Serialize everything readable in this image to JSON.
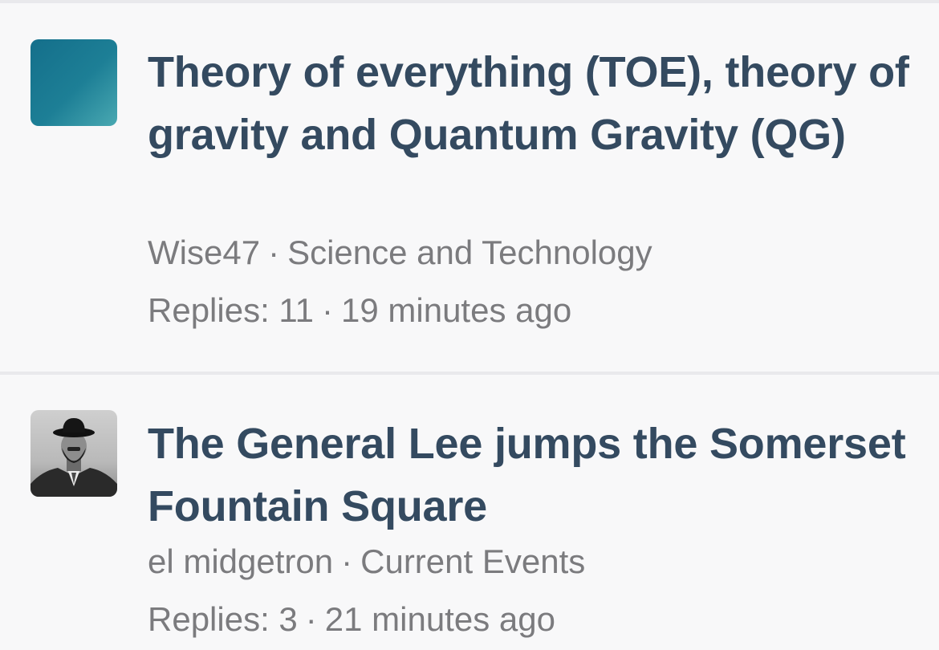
{
  "threads": [
    {
      "title": "Theory of everything (TOE), theory of gravity and Quantum Gravity (QG)",
      "author": "Wise47",
      "separator": "·",
      "forum": "Science and Technology",
      "replies": "Replies: 11",
      "time": "19 minutes ago",
      "avatar_icon": "teal-gradient-avatar"
    },
    {
      "title": "The General Lee jumps the Somerset Fountain Square",
      "author": "el midgetron",
      "separator": "·",
      "forum": "Current Events",
      "replies": "Replies: 3",
      "time": "21 minutes ago",
      "avatar_icon": "man-in-bowler-hat-avatar"
    }
  ],
  "colors": {
    "background": "#f8f8f9",
    "title": "#344a60",
    "meta": "#7b7b7e",
    "divider": "#e9e9ec"
  }
}
